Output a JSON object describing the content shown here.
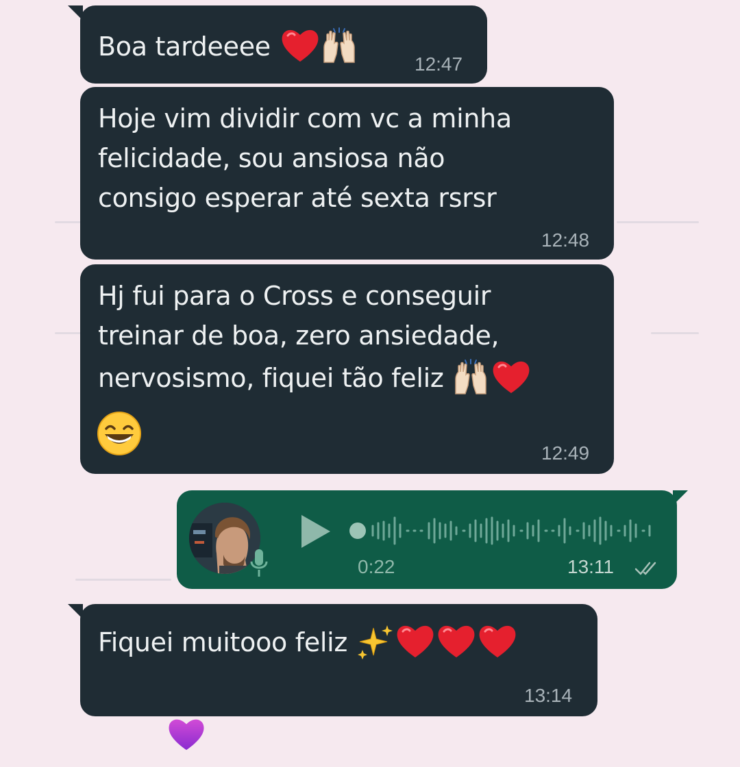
{
  "messages": [
    {
      "text": "Boa tardeeee",
      "time": "12:47"
    },
    {
      "lines": [
        "Hoje vim dividir com vc a minha",
        "felicidade, sou ansiosa não",
        "consigo esperar até sexta rsrsr"
      ],
      "time": "12:48"
    },
    {
      "lines": [
        "Hj fui para o Cross e conseguir",
        "treinar de boa, zero ansiedade,",
        "nervosismo, fiquei tão feliz"
      ],
      "time": "12:49"
    },
    {
      "text": "Fiquei muitooo feliz",
      "time": "13:14"
    }
  ],
  "voice_note": {
    "duration": "0:22",
    "time": "13:11",
    "status": "delivered"
  },
  "colors": {
    "background": "#f6e9ef",
    "incoming_bubble": "#1f2c34",
    "outgoing_bubble": "#0f5c47",
    "reaction_heart": "#b63ad6"
  }
}
